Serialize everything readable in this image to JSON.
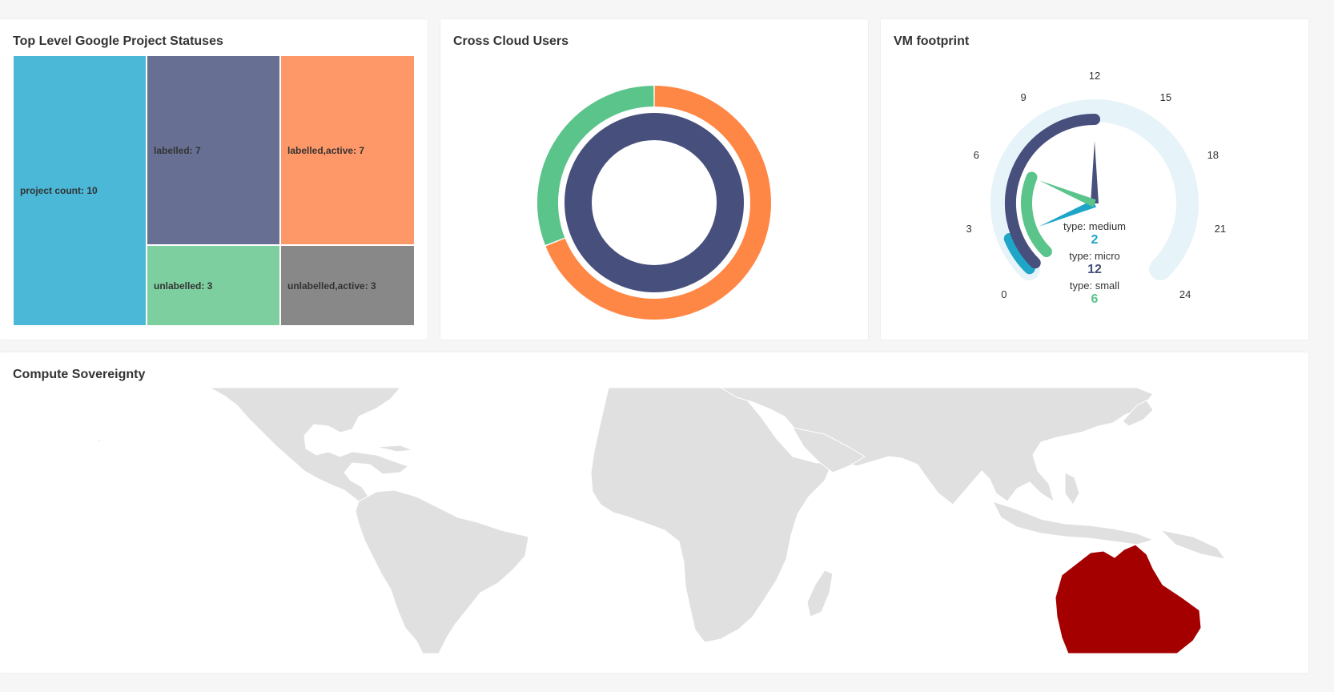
{
  "panels": {
    "treemap": {
      "title": "Top Level Google Project Statuses",
      "cells": [
        {
          "label": "project count: 10",
          "color": "#4ab8d6"
        },
        {
          "label": "labelled: 7",
          "color": "#677093"
        },
        {
          "label": "labelled,active: 7",
          "color": "#ff9868"
        },
        {
          "label": "unlabelled: 3",
          "color": "#7ecf9f"
        },
        {
          "label": "unlabelled,active: 3",
          "color": "#888888"
        }
      ]
    },
    "donut": {
      "title": "Cross Cloud Users"
    },
    "gauge": {
      "title": "VM footprint",
      "ticks": [
        "0",
        "3",
        "6",
        "9",
        "12",
        "15",
        "18",
        "21",
        "24"
      ],
      "readouts": [
        {
          "label": "type: medium",
          "value": "2",
          "color": "#1ea5c8"
        },
        {
          "label": "type: micro",
          "value": "12",
          "color": "#474f7c"
        },
        {
          "label": "type: small",
          "value": "6",
          "color": "#5bc48a"
        }
      ]
    },
    "map": {
      "title": "Compute Sovereignty",
      "land_color": "#e0e0e0",
      "highlight_color": "#a50000",
      "highlight_region": "Australia"
    }
  },
  "chart_data": [
    {
      "type": "treemap",
      "title": "Top Level Google Project Statuses",
      "nodes": [
        {
          "name": "project count",
          "value": 10
        },
        {
          "name": "labelled",
          "value": 7
        },
        {
          "name": "labelled,active",
          "value": 7
        },
        {
          "name": "unlabelled",
          "value": 3
        },
        {
          "name": "unlabelled,active",
          "value": 3
        }
      ]
    },
    {
      "type": "pie",
      "title": "Cross Cloud Users",
      "rings": [
        {
          "ring": "outer",
          "slices": [
            {
              "value": 0.31,
              "color": "#5bc48a"
            },
            {
              "value": 0.69,
              "color": "#ff8745"
            }
          ]
        },
        {
          "ring": "inner",
          "slices": [
            {
              "value": 1.0,
              "color": "#474f7c"
            }
          ]
        }
      ]
    },
    {
      "type": "gauge",
      "title": "VM footprint",
      "range": [
        0,
        24
      ],
      "series": [
        {
          "name": "type: medium",
          "value": 2,
          "color": "#1ea5c8"
        },
        {
          "name": "type: micro",
          "value": 12,
          "color": "#474f7c"
        },
        {
          "name": "type: small",
          "value": 6,
          "color": "#5bc48a"
        }
      ]
    }
  ]
}
